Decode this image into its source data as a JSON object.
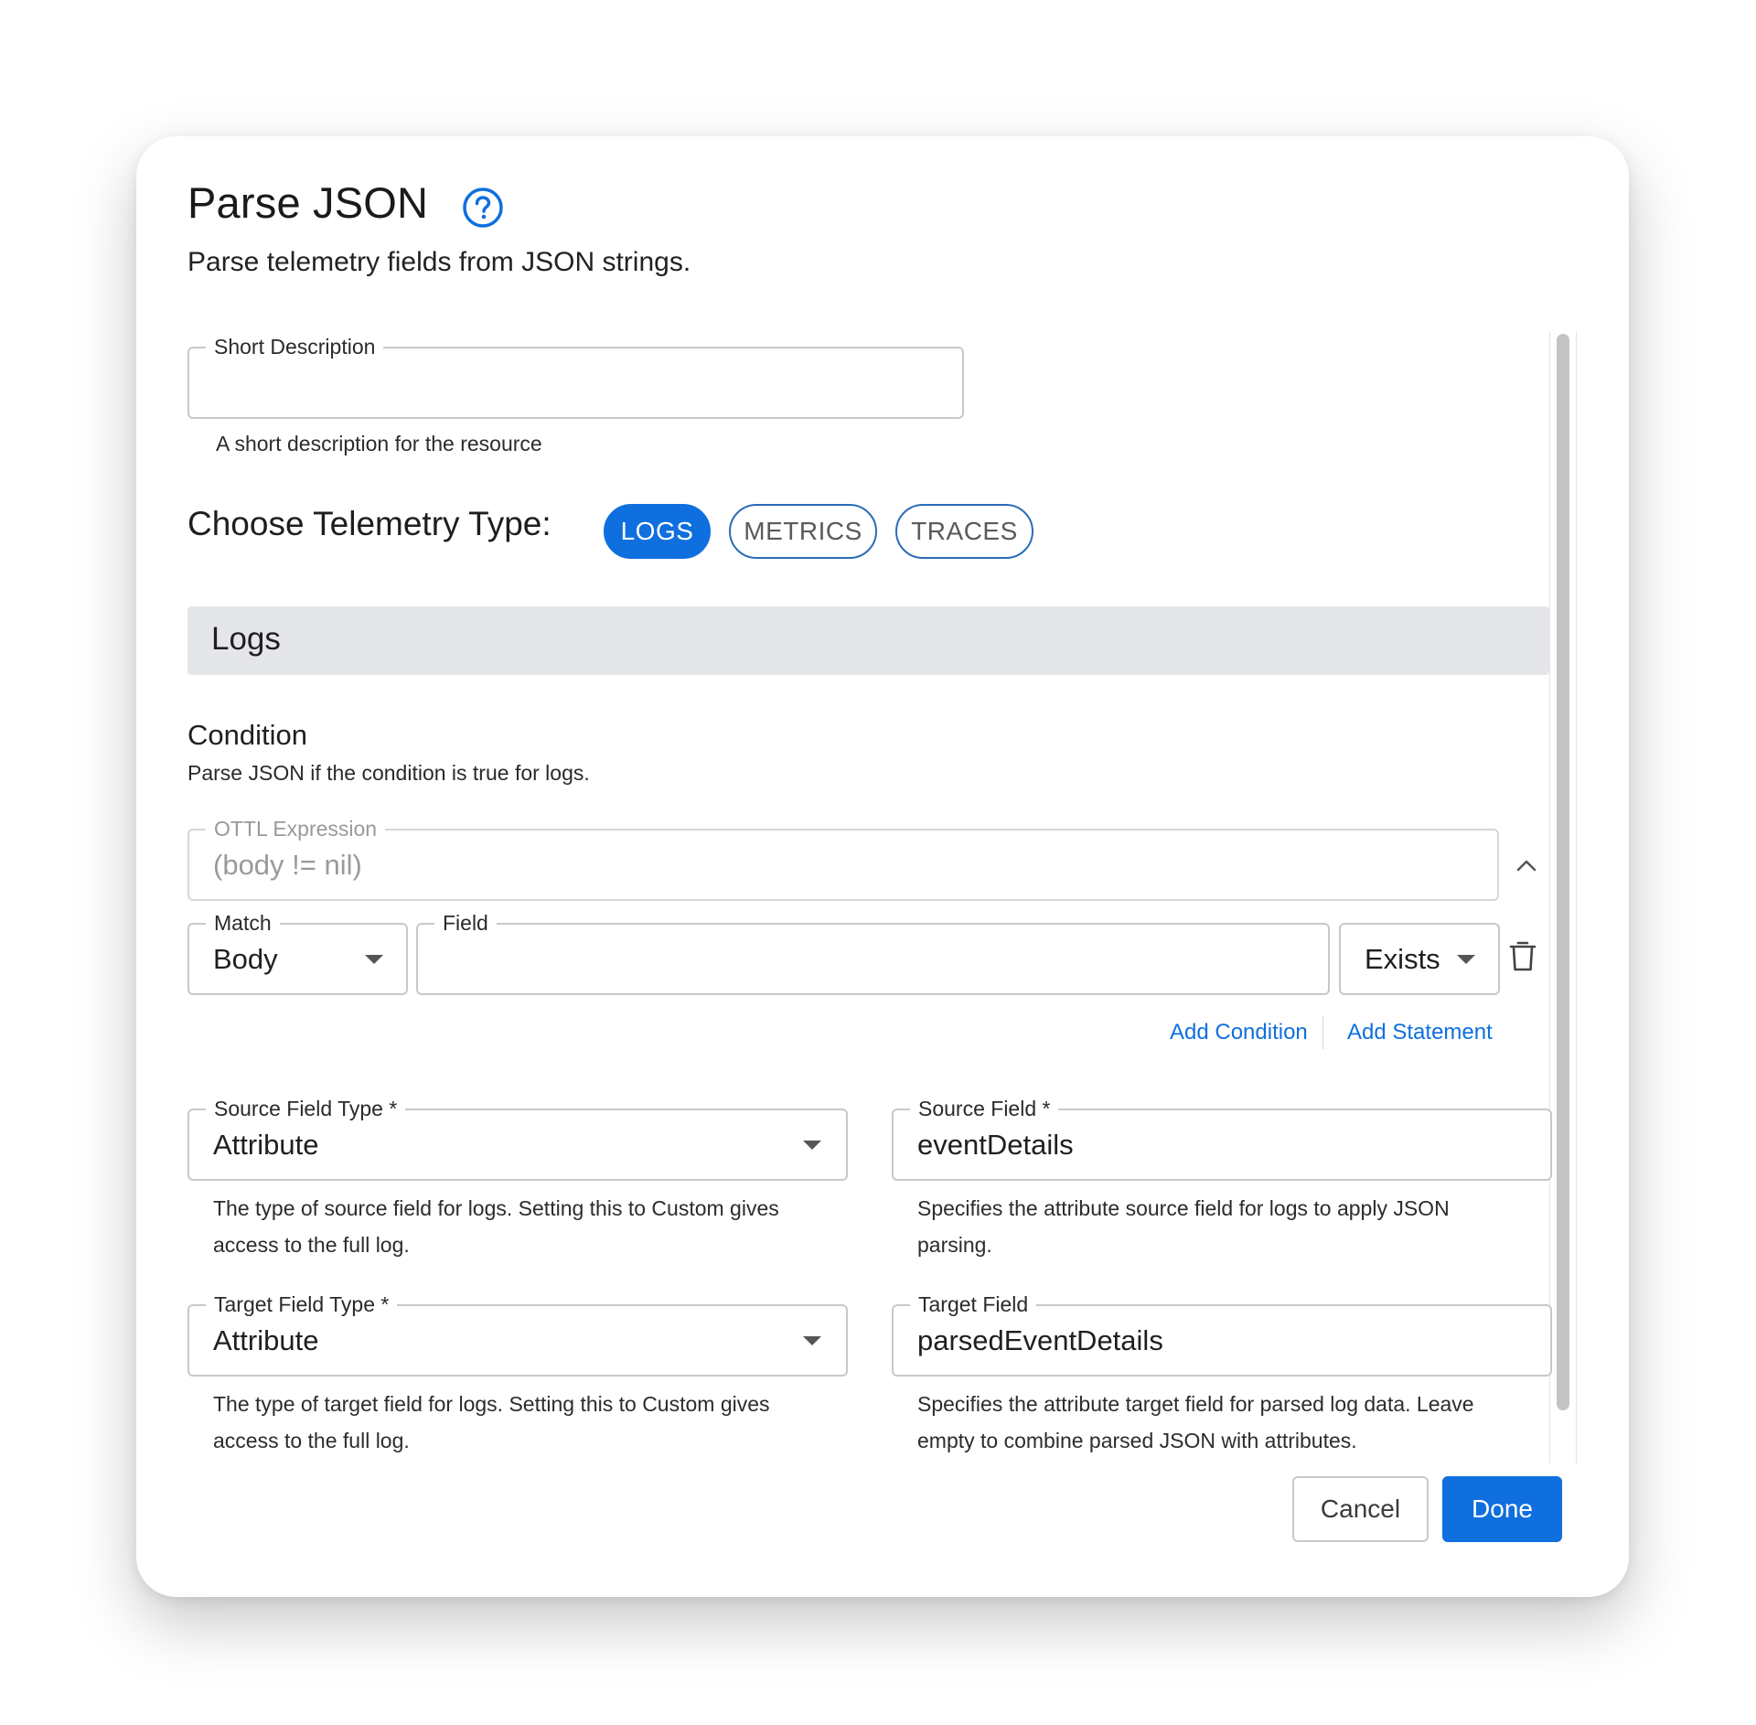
{
  "dialog": {
    "title": "Parse JSON",
    "subtitle": "Parse telemetry fields from JSON strings."
  },
  "short_description": {
    "label": "Short Description",
    "value": "",
    "helper": "A short description for the resource"
  },
  "telemetry": {
    "label": "Choose Telemetry Type:",
    "options": [
      "LOGS",
      "METRICS",
      "TRACES"
    ],
    "selected": "LOGS"
  },
  "section": {
    "title": "Logs"
  },
  "condition": {
    "title": "Condition",
    "description": "Parse JSON if the condition is true for logs.",
    "ottl_label": "OTTL Expression",
    "ottl_value": "(body != nil)",
    "match_label": "Match",
    "match_value": "Body",
    "field_label": "Field",
    "field_value": "",
    "operator_value": "Exists",
    "add_condition": "Add Condition",
    "add_statement": "Add Statement"
  },
  "source_field_type": {
    "label": "Source Field Type *",
    "value": "Attribute",
    "helper_line1": "The type of source field for logs. Setting this to Custom gives",
    "helper_line2": "access to the full log."
  },
  "source_field": {
    "label": "Source Field *",
    "value": "eventDetails",
    "helper_line1": "Specifies the attribute source field for logs to apply JSON",
    "helper_line2": "parsing."
  },
  "target_field_type": {
    "label": "Target Field Type *",
    "value": "Attribute",
    "helper_line1": "The type of target field for logs. Setting this to Custom gives",
    "helper_line2": "access to the full log."
  },
  "target_field": {
    "label": "Target Field",
    "value": "parsedEventDetails",
    "helper_line1": "Specifies the attribute target field for parsed log data. Leave",
    "helper_line2": "empty to combine parsed JSON with attributes."
  },
  "footer": {
    "cancel_label": "Cancel",
    "done_label": "Done"
  },
  "colors": {
    "accent": "#0f6fde",
    "section_bg": "#e4e6ea",
    "border": "#c8c8c8"
  },
  "icons": {
    "help": "help-circle-icon",
    "collapse": "chevron-up-icon",
    "delete": "trash-icon",
    "dropdown": "caret-down-icon"
  }
}
